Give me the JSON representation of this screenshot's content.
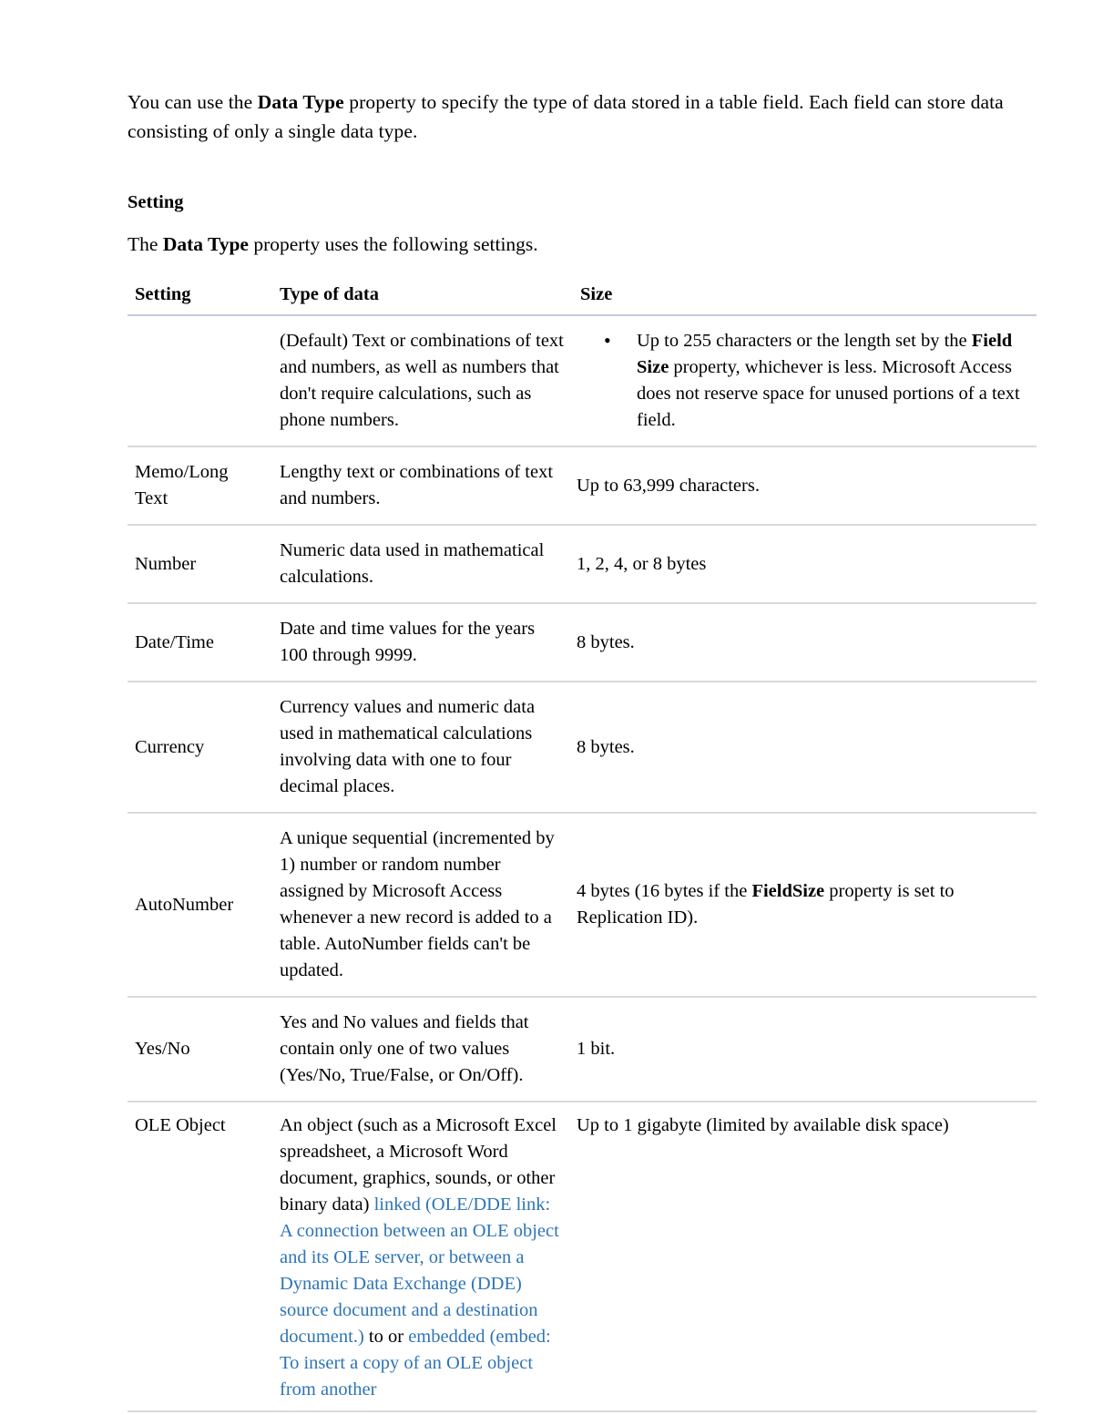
{
  "document": {
    "intro_paragraph": {
      "part1": "You can use the ",
      "emphasis1": "Data Type",
      "part2": " property to specify the type of data stored in a table field. Each field can store data consisting of only a single data type."
    },
    "section_heading": "Setting",
    "lead_paragraph": {
      "part1": "The ",
      "emphasis1": "Data Type",
      "part2": " property uses the following settings."
    },
    "table": {
      "headers": {
        "setting": "Setting",
        "type_of_data": "Type of data",
        "size": "Size"
      },
      "rows": [
        {
          "setting": "",
          "type_of_data": "(Default) Text or combinations of text and numbers, as well as numbers that don't require calculations, such as phone numbers.",
          "size_bulleted": true,
          "size_parts": {
            "part1": "Up to 255 characters or the length set by the ",
            "emphasis1": "Field Size",
            "part2": " property, whichever is less. Microsoft Access does not reserve space for unused portions of a text field."
          }
        },
        {
          "setting": "Memo/Long Text",
          "type_of_data": "Lengthy text or combinations of text and numbers.",
          "size": "Up to 63,999 characters."
        },
        {
          "setting": "Number",
          "type_of_data": "Numeric data used in mathematical calculations.",
          "size": "1, 2, 4, or 8 bytes"
        },
        {
          "setting": "Date/Time",
          "type_of_data": "Date and time values for the years 100 through 9999.",
          "size": "8 bytes."
        },
        {
          "setting": "Currency",
          "type_of_data": "Currency values and numeric data used in mathematical calculations involving data with one to four decimal places.",
          "size": "8 bytes."
        },
        {
          "setting": "AutoNumber",
          "type_of_data": "A unique sequential (incremented by 1) number or random number assigned by Microsoft Access whenever a new record is added to a table. AutoNumber fields can't be updated.",
          "size_parts": {
            "part1": "4 bytes (16 bytes if the ",
            "emphasis1": "FieldSize",
            "part2": " property is set to Replication ID)."
          }
        },
        {
          "setting": "Yes/No",
          "type_of_data": "Yes and No values and fields that contain only one of two values (Yes/No, True/False, or On/Off).",
          "size": "1 bit."
        },
        {
          "setting": "OLE Object",
          "type_of_data_parts": {
            "black1": "An object (such as a Microsoft Excel spreadsheet, a Microsoft Word document, graphics, sounds, or other binary data) ",
            "link1": "linked (OLE/DDE link: A connection between an OLE object and its OLE server, or between a Dynamic Data Exchange (DDE) source document and a destination document.)",
            "black2": " to or ",
            "link2": "embedded (embed: To insert a copy of an OLE object from another"
          },
          "size": "Up to 1 gigabyte (limited by available disk space)"
        }
      ]
    }
  },
  "colors": {
    "link_blue": "#2e74b5",
    "header_rule": "#c3cbdb",
    "row_rule": "#d9d9d9",
    "text": "#000000",
    "background": "#ffffff"
  }
}
